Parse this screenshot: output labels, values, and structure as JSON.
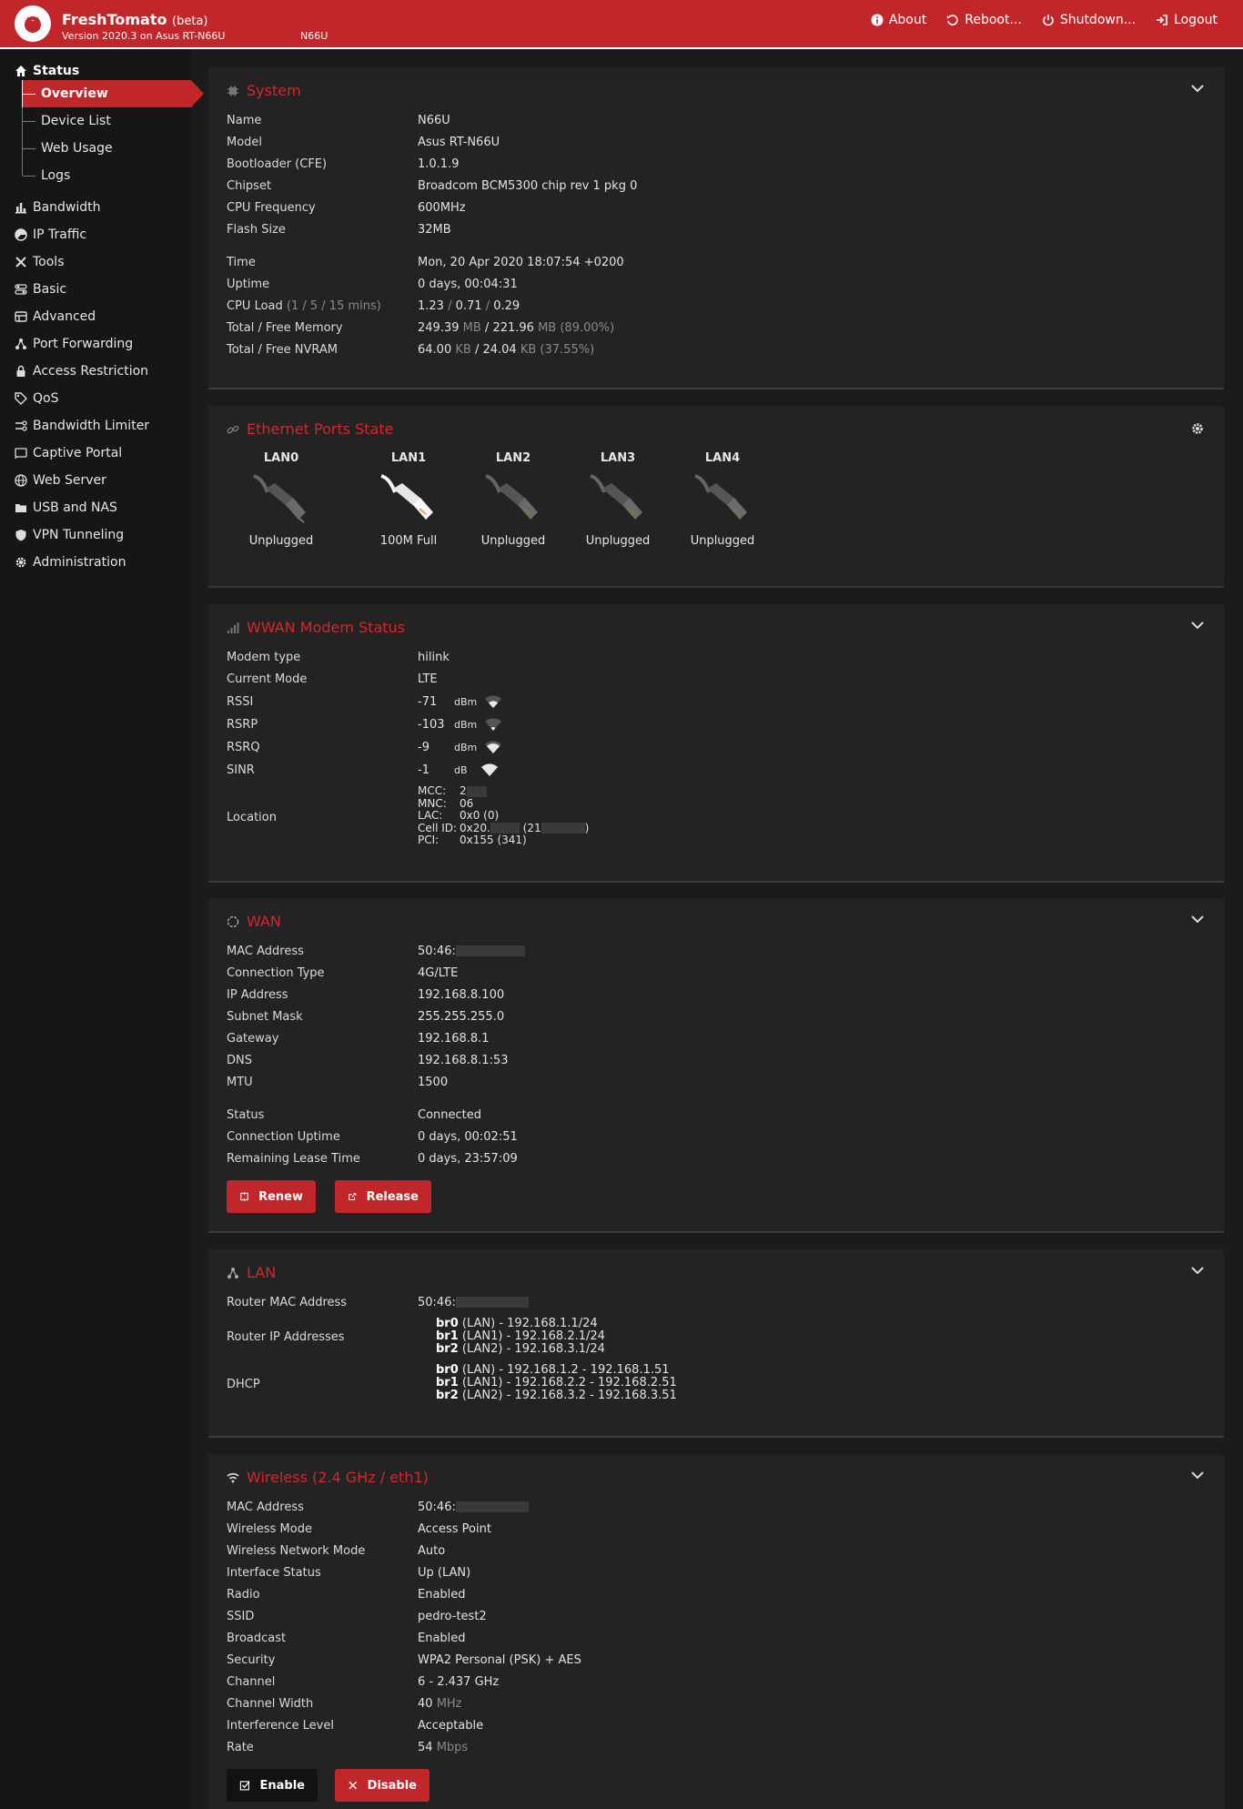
{
  "header": {
    "brand": "FreshTomato",
    "brand_suffix": "(beta)",
    "version": "Version 2020.3 on Asus RT-N66U",
    "hostname": "N66U",
    "nav": {
      "about": "About",
      "reboot": "Reboot...",
      "shutdown": "Shutdown...",
      "logout": "Logout"
    }
  },
  "sidebar": {
    "status": "Status",
    "sub": [
      "Overview",
      "Device List",
      "Web Usage",
      "Logs"
    ],
    "items": [
      "Bandwidth",
      "IP Traffic",
      "Tools",
      "Basic",
      "Advanced",
      "Port Forwarding",
      "Access Restriction",
      "QoS",
      "Bandwidth Limiter",
      "Captive Portal",
      "Web Server",
      "USB and NAS",
      "VPN Tunneling",
      "Administration"
    ]
  },
  "system": {
    "title": "System",
    "rows": [
      {
        "k": "Name",
        "v": "N66U"
      },
      {
        "k": "Model",
        "v": "Asus RT-N66U"
      },
      {
        "k": "Bootloader (CFE)",
        "v": "1.0.1.9"
      },
      {
        "k": "Chipset",
        "v": "Broadcom BCM5300 chip rev 1 pkg 0"
      },
      {
        "k": "CPU Frequency",
        "v": "600MHz"
      },
      {
        "k": "Flash Size",
        "v": "32MB"
      },
      {
        "k": "Time",
        "v": "Mon, 20 Apr 2020 18:07:54 +0200"
      },
      {
        "k": "Uptime",
        "v": "0 days, 00:04:31"
      }
    ],
    "cpu_load": {
      "k": "CPU Load",
      "hint": "(1 / 5 / 15 mins)",
      "v1": "1.23",
      "sep": "/",
      "v2": "0.71",
      "v3": "0.29"
    },
    "memory": {
      "k": "Total / Free Memory",
      "total": "249.39",
      "unit": "MB",
      "free": "221.96",
      "pct": "(89.00%)"
    },
    "nvram": {
      "k": "Total / Free NVRAM",
      "total": "64.00",
      "unit": "KB",
      "free": "24.04",
      "pct": "(37.55%)"
    }
  },
  "ethernet": {
    "title": "Ethernet Ports State",
    "ports": [
      {
        "label": "LAN0",
        "state": "Unplugged",
        "active": false
      },
      {
        "label": "LAN1",
        "state": "100M Full",
        "active": true
      },
      {
        "label": "LAN2",
        "state": "Unplugged",
        "active": false
      },
      {
        "label": "LAN3",
        "state": "Unplugged",
        "active": false
      },
      {
        "label": "LAN4",
        "state": "Unplugged",
        "active": false
      }
    ]
  },
  "wwan": {
    "title": "WWAN Modem Status",
    "modem_type": {
      "k": "Modem type",
      "v": "hilink"
    },
    "mode": {
      "k": "Current Mode",
      "v": "LTE"
    },
    "signals": [
      {
        "k": "RSSI",
        "v": "-71",
        "unit": "dBm",
        "bars": 2
      },
      {
        "k": "RSRP",
        "v": "-103",
        "unit": "dBm",
        "bars": 1
      },
      {
        "k": "RSRQ",
        "v": "-9",
        "unit": "dBm",
        "bars": 3
      },
      {
        "k": "SINR",
        "v": "-1",
        "unit": "dB",
        "bars": 4
      }
    ],
    "location": {
      "k": "Location",
      "lines": [
        {
          "k": "MCC:",
          "v": "2"
        },
        {
          "k": "MNC:",
          "v": "06"
        },
        {
          "k": "LAC:",
          "v": "0x0 (0)"
        },
        {
          "k": "Cell ID:",
          "v": "0x20.",
          "v2": "(21",
          "v3": ")"
        },
        {
          "k": "PCI:",
          "v": "0x155 (341)"
        }
      ]
    }
  },
  "wan": {
    "title": "WAN",
    "rows": [
      {
        "k": "MAC Address",
        "v": "50:46:"
      },
      {
        "k": "Connection Type",
        "v": "4G/LTE"
      },
      {
        "k": "IP Address",
        "v": "192.168.8.100"
      },
      {
        "k": "Subnet Mask",
        "v": "255.255.255.0"
      },
      {
        "k": "Gateway",
        "v": "192.168.8.1"
      },
      {
        "k": "DNS",
        "v": "192.168.8.1:53"
      },
      {
        "k": "MTU",
        "v": "1500"
      },
      {
        "k": "Status",
        "v": "Connected"
      },
      {
        "k": "Connection Uptime",
        "v": "0 days, 00:02:51"
      },
      {
        "k": "Remaining Lease Time",
        "v": "0 days, 23:57:09"
      }
    ],
    "renew": "Renew",
    "release": "Release"
  },
  "lan": {
    "title": "LAN",
    "mac": {
      "k": "Router MAC Address",
      "v": "50:46:"
    },
    "ips_label": "Router IP Addresses",
    "ips": [
      {
        "br": "br0",
        "rest": "(LAN) - 192.168.1.1/24"
      },
      {
        "br": "br1",
        "rest": "(LAN1) - 192.168.2.1/24"
      },
      {
        "br": "br2",
        "rest": "(LAN2) - 192.168.3.1/24"
      }
    ],
    "dhcp_label": "DHCP",
    "dhcp": [
      {
        "br": "br0",
        "rest": "(LAN) - 192.168.1.2 - 192.168.1.51"
      },
      {
        "br": "br1",
        "rest": "(LAN1) - 192.168.2.2 - 192.168.2.51"
      },
      {
        "br": "br2",
        "rest": "(LAN2) - 192.168.3.2 - 192.168.3.51"
      }
    ]
  },
  "wireless": {
    "title": "Wireless (2.4 GHz / eth1)",
    "rows": [
      {
        "k": "MAC Address",
        "v": "50:46:"
      },
      {
        "k": "Wireless Mode",
        "v": "Access Point"
      },
      {
        "k": "Wireless Network Mode",
        "v": "Auto"
      },
      {
        "k": "Interface Status",
        "v": "Up (LAN)"
      },
      {
        "k": "Radio",
        "v": "Enabled"
      },
      {
        "k": "SSID",
        "v": "pedro-test2"
      },
      {
        "k": "Broadcast",
        "v": "Enabled"
      },
      {
        "k": "Security",
        "v": "WPA2 Personal (PSK) + AES"
      }
    ],
    "channel": {
      "k": "Channel",
      "v": "6 - 2.437 GHz"
    },
    "width": {
      "k": "Channel Width",
      "v": "40",
      "unit": "MHz"
    },
    "interference": {
      "k": "Interference Level",
      "v": "Acceptable"
    },
    "rate": {
      "k": "Rate",
      "v": "54",
      "unit": "Mbps"
    },
    "enable": "Enable",
    "disable": "Disable"
  },
  "colors": {
    "accent": "#c1262b",
    "background": "#1b1b1b",
    "panel": "#232323"
  }
}
